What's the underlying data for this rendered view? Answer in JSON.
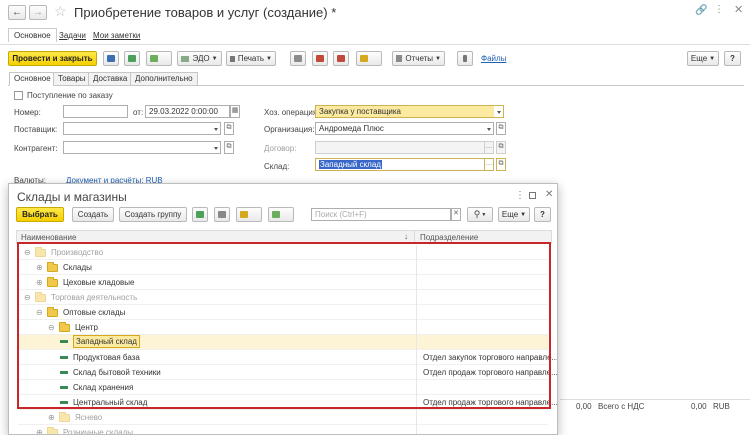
{
  "window": {
    "title": "Приобретение товаров и услуг (создание) *",
    "nav_tabs": [
      "Основное",
      "Задачи",
      "Мои заметки"
    ]
  },
  "toolbar": {
    "post_close": "Провести и закрыть",
    "edo": "ЭДО",
    "print": "Печать",
    "reports": "Отчеты",
    "files": "Файлы",
    "more": "Еще",
    "help": "?"
  },
  "doc_tabs": [
    "Основное",
    "Товары",
    "Доставка",
    "Дополнительно"
  ],
  "form": {
    "by_order_label": "Поступление по заказу",
    "number_label": "Номер:",
    "from_label": "от:",
    "date_value": "29.03.2022  0:00:00",
    "supplier_label": "Поставщик:",
    "counterparty_label": "Контрагент:",
    "operation_label": "Хоз. операция:",
    "operation_value": "Закупка у поставщика",
    "organization_label": "Организация:",
    "organization_value": "Андромеда Плюс",
    "contract_label": "Договор:",
    "warehouse_label": "Склад:",
    "warehouse_value": "Западный склад",
    "currency_label": "Валюты:",
    "currency_value": "Документ и расчёты: RUB"
  },
  "footer": {
    "amount1": "0,00",
    "vat_label": "Всего с НДС",
    "amount2": "0,00",
    "currency": "RUB"
  },
  "dialog": {
    "title": "Склады и магазины",
    "select": "Выбрать",
    "create": "Создать",
    "create_group": "Создать группу",
    "search_placeholder": "Поиск (Ctrl+F)",
    "more": "Еще",
    "help": "?",
    "col_name": "Наименование",
    "col_dept": "Подразделение",
    "rows": [
      {
        "name": "Производство",
        "dept": "",
        "type": "folder",
        "faded": true
      },
      {
        "name": "Склады",
        "dept": "",
        "type": "folder",
        "faded": false
      },
      {
        "name": "Цеховые кладовые",
        "dept": "",
        "type": "folder",
        "faded": false
      },
      {
        "name": "Торговая деятельность",
        "dept": "",
        "type": "folder",
        "faded": true
      },
      {
        "name": "Оптовые склады",
        "dept": "",
        "type": "folder",
        "faded": false
      },
      {
        "name": "Центр",
        "dept": "",
        "type": "folder",
        "faded": false
      },
      {
        "name": "Западный склад",
        "dept": "",
        "type": "item",
        "faded": false
      },
      {
        "name": "Продуктовая база",
        "dept": "Отдел закупок торгового направле...",
        "type": "item",
        "faded": false
      },
      {
        "name": "Склад бытовой техники",
        "dept": "Отдел продаж торгового направле...",
        "type": "item",
        "faded": false
      },
      {
        "name": "Склад хранения",
        "dept": "",
        "type": "item",
        "faded": false
      },
      {
        "name": "Центральный склад",
        "dept": "Отдел продаж торгового направле...",
        "type": "item",
        "faded": false
      },
      {
        "name": "Яснево",
        "dept": "",
        "type": "folder",
        "faded": true
      },
      {
        "name": "Розничные склады",
        "dept": "",
        "type": "folder",
        "faded": true
      }
    ]
  },
  "colors": {
    "accent_yellow": "#f5d000",
    "highlight_red": "#c8262b",
    "selected_row": "#fbeaa0",
    "link_blue": "#1f5fb4"
  }
}
